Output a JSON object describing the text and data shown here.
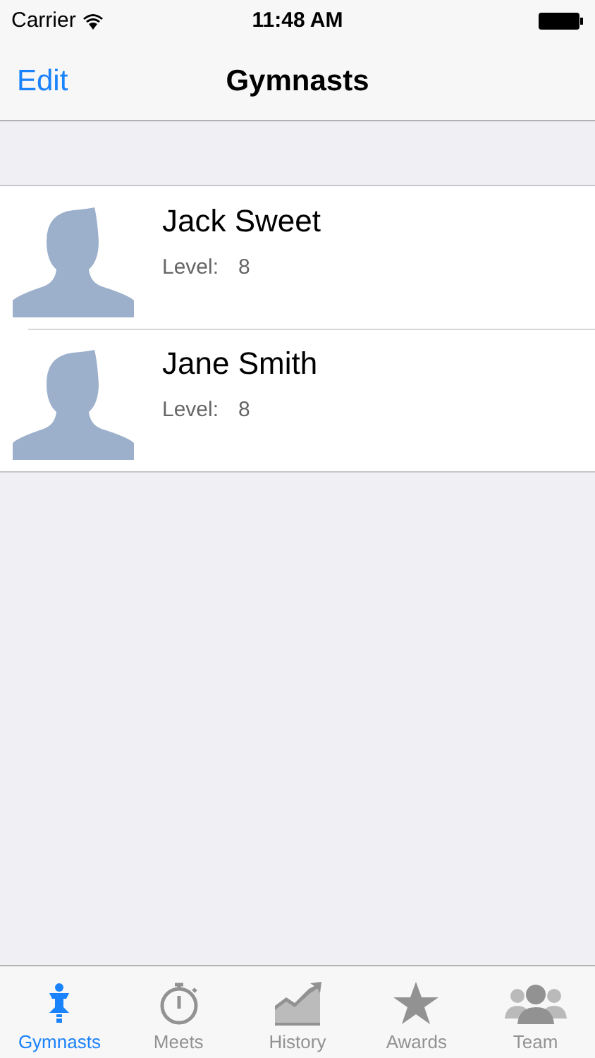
{
  "status_bar": {
    "carrier": "Carrier",
    "time": "11:48 AM"
  },
  "nav_bar": {
    "left_button": "Edit",
    "title": "Gymnasts"
  },
  "gymnasts": [
    {
      "name": "Jack Sweet",
      "level_label": "Level:",
      "level_value": "8"
    },
    {
      "name": "Jane Smith",
      "level_label": "Level:",
      "level_value": "8"
    }
  ],
  "tab_bar": [
    {
      "label": "Gymnasts",
      "selected": true
    },
    {
      "label": "Meets",
      "selected": false
    },
    {
      "label": "History",
      "selected": false
    },
    {
      "label": "Awards",
      "selected": false
    },
    {
      "label": "Team",
      "selected": false
    }
  ]
}
